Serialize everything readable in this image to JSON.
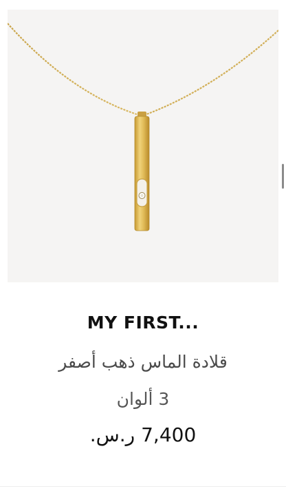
{
  "product": {
    "image_alt": "gold bar pendant necklace with diamond",
    "name": "MY FIRST...",
    "description": "قلادة الماس ذهب أصفر",
    "colors_label": "3 ألوان",
    "price": "7,400 ر.س."
  },
  "colors": {
    "image_background": "#f5f4f3",
    "gold": "#d6b24f",
    "text_primary": "#111111",
    "text_secondary": "#4a4a4a"
  }
}
